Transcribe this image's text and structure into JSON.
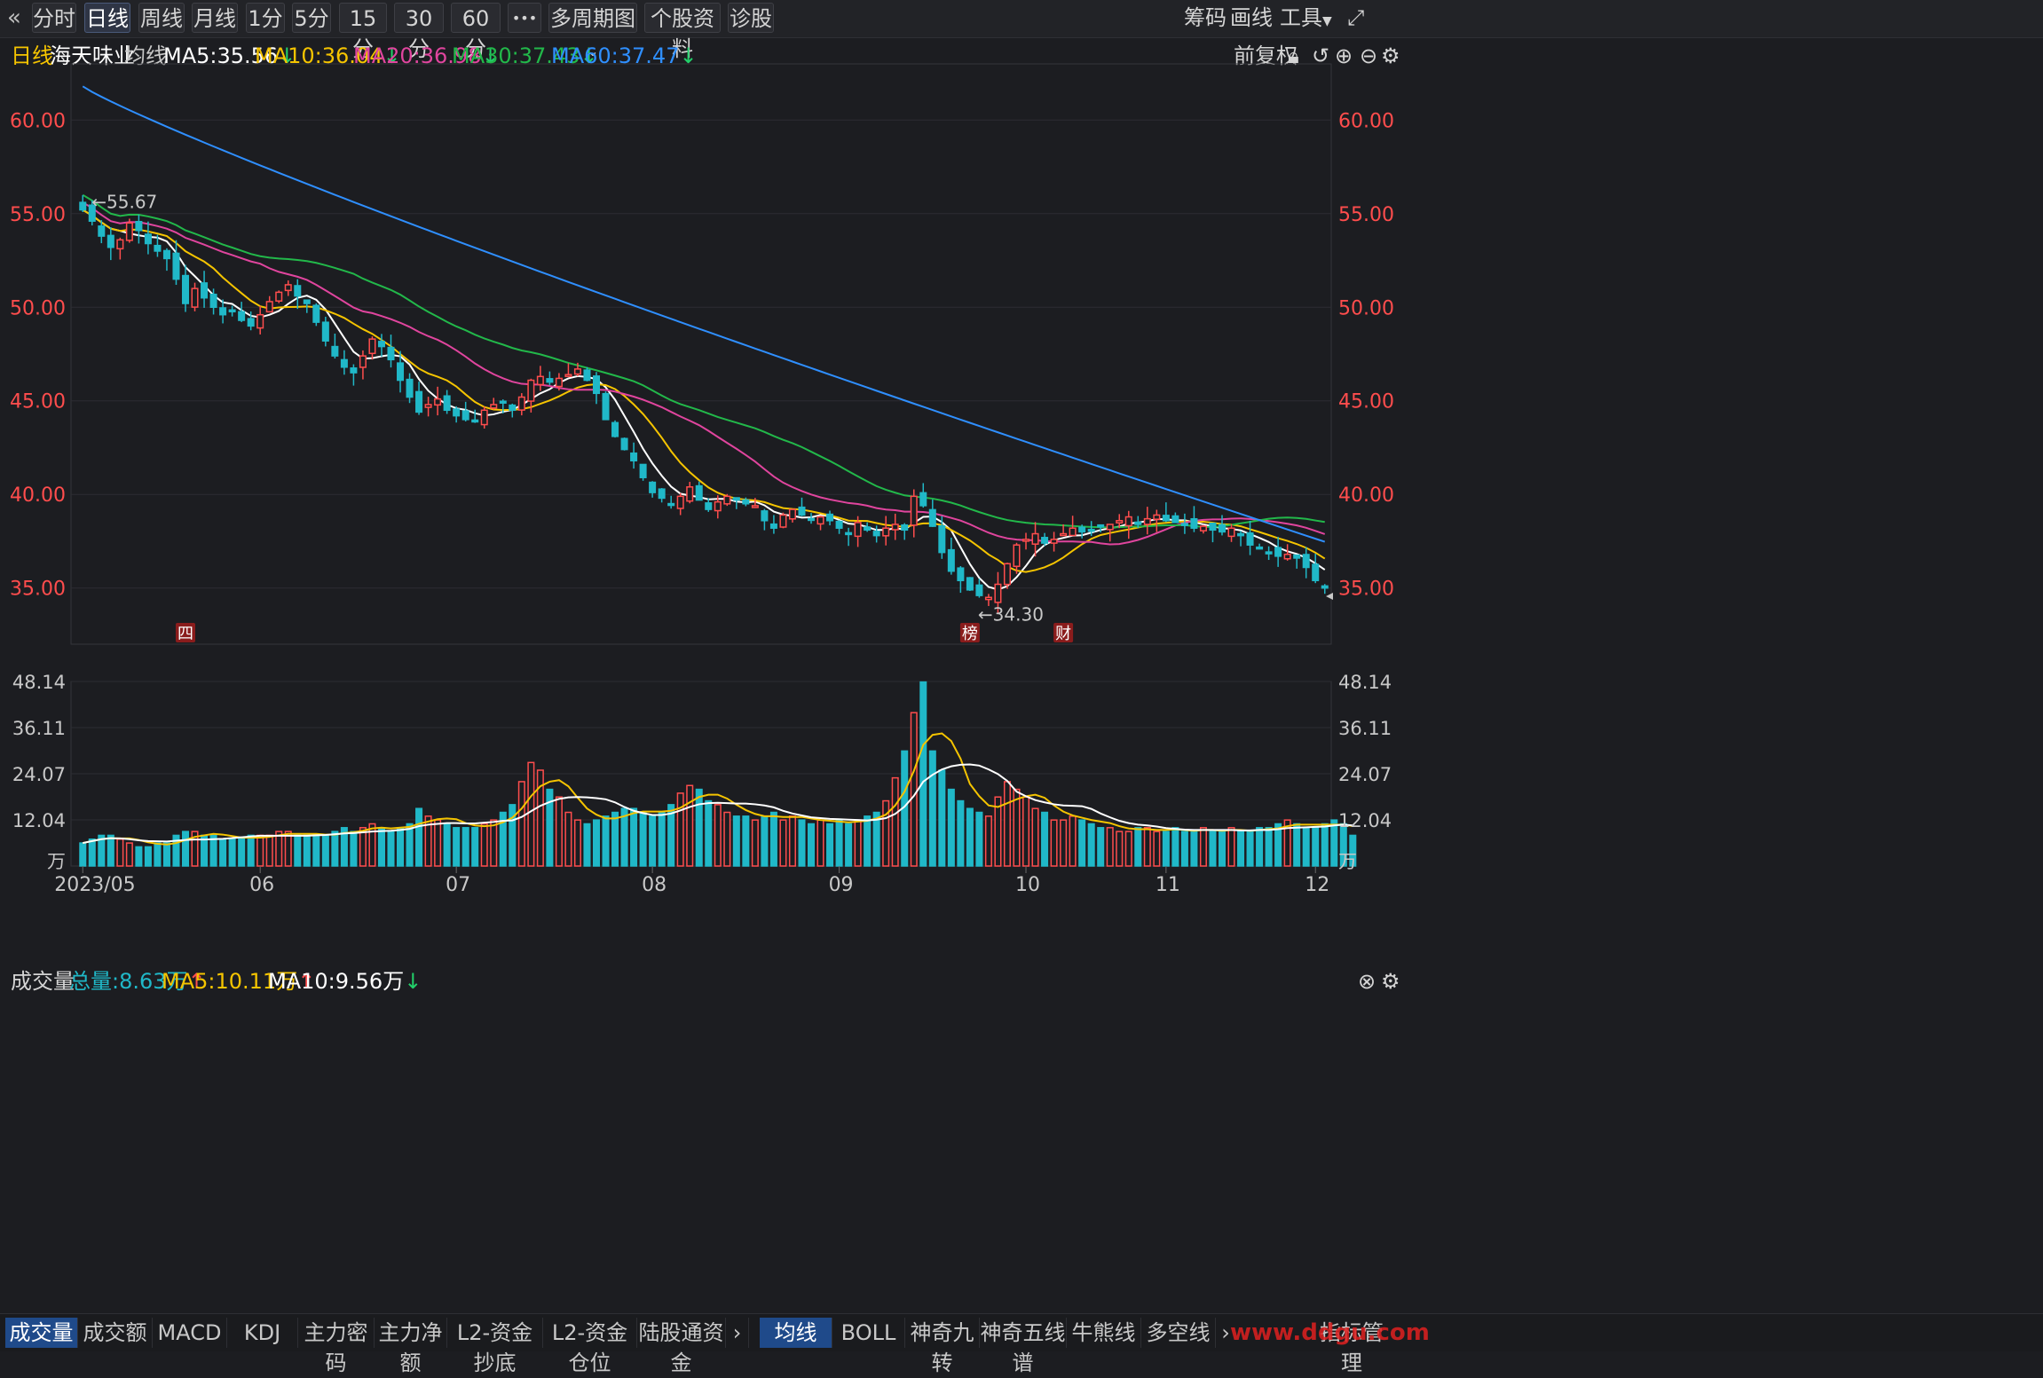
{
  "toolbar": {
    "back_icon": "double-chevron-left-icon",
    "tabs": [
      "分时",
      "日线",
      "周线",
      "月线",
      "1分",
      "5分",
      "15分",
      "30分",
      "60分",
      "•••",
      "多周期图",
      "个股资料",
      "诊股"
    ],
    "active_tab": "日线",
    "right": {
      "chips": "筹码",
      "draw": "画线",
      "tools": "工具"
    }
  },
  "info": {
    "period": "日线",
    "stock_name": "海天味业",
    "ma_label": "均线",
    "ma5": "MA5:35.56",
    "ma10": "MA10:36.04",
    "ma20": "MA20:36.98",
    "ma30": "MA30:37.43",
    "ma60": "MA60:37.47",
    "adjust": "前复权",
    "colors": {
      "ma5": "#ffffff",
      "ma10": "#f5c400",
      "ma20": "#e0459e",
      "ma30": "#22b84a",
      "ma60": "#2f8fff",
      "up": "#ff4d4d",
      "down": "#20b8c8",
      "axis_red": "#ff4d4d"
    }
  },
  "price_axis": {
    "labels": [
      "60.00",
      "55.00",
      "50.00",
      "45.00",
      "40.00",
      "35.00"
    ]
  },
  "annotations": {
    "high": "55.67",
    "low": "←34.30",
    "markers": [
      "四",
      "榜",
      "财"
    ]
  },
  "volume": {
    "title": "成交量",
    "total": "总量:8.63万",
    "ma5": "MA5:10.11万",
    "ma10": "MA10:9.56万",
    "axis": [
      "48.14",
      "36.11",
      "24.07",
      "12.04",
      "万"
    ]
  },
  "x_axis": {
    "labels": [
      "2023/05",
      "06",
      "07",
      "08",
      "09",
      "10",
      "11",
      "12"
    ]
  },
  "bottom_tabs": {
    "left": [
      "成交量",
      "成交额",
      "MACD",
      "KDJ",
      "主力密码",
      "主力净额",
      "L2-资金抄底",
      "L2-资金仓位",
      "陆股通资金"
    ],
    "right": [
      "均线",
      "BOLL",
      "神奇九转",
      "神奇五线谱",
      "牛熊线",
      "多空线"
    ],
    "manage": "指标管理",
    "watermark": "www.ddgu.com"
  },
  "chart_data": {
    "type": "candlestick",
    "title": "海天味业",
    "ylim": [
      32.0,
      63.0
    ],
    "volume_ylim": [
      0,
      48.14
    ],
    "months": [
      "2023/05",
      "06",
      "07",
      "08",
      "09",
      "10",
      "11",
      "12"
    ],
    "high": 55.67,
    "low": 34.3,
    "ma_last": {
      "MA5": 35.56,
      "MA10": 36.04,
      "MA20": 36.98,
      "MA30": 37.43,
      "MA60": 37.47
    },
    "close_path": [
      55.2,
      54.6,
      53.8,
      53.2,
      53.6,
      54.5,
      54.1,
      53.4,
      53.0,
      52.6,
      51.5,
      50.2,
      51.0,
      50.5,
      50.0,
      49.6,
      49.8,
      49.3,
      49.0,
      49.6,
      50.3,
      50.8,
      51.2,
      50.6,
      50.2,
      49.2,
      48.2,
      47.4,
      46.8,
      46.5,
      47.4,
      48.3,
      47.9,
      47.2,
      46.1,
      45.2,
      44.4,
      44.8,
      45.1,
      44.5,
      44.2,
      44.0,
      43.9,
      44.5,
      44.8,
      44.9,
      44.5,
      45.2,
      46.1,
      46.3,
      46.0,
      46.2,
      46.4,
      46.7,
      46.1,
      45.4,
      44.0,
      43.1,
      42.4,
      41.8,
      40.9,
      40.1,
      39.8,
      39.5,
      39.9,
      40.4,
      39.7,
      39.2,
      39.6,
      39.9,
      39.7,
      39.5,
      39.4,
      38.6,
      38.2,
      38.9,
      39.2,
      38.9,
      38.7,
      38.8,
      38.6,
      38.2,
      37.9,
      38.5,
      38.1,
      37.8,
      38.2,
      38.4,
      38.1,
      39.9,
      39.4,
      38.3,
      36.9,
      35.9,
      35.4,
      34.9,
      34.6,
      34.5,
      35.2,
      36.3,
      37.3,
      37.6,
      37.9,
      37.4,
      37.6,
      37.9,
      38.2,
      38.0,
      38.1,
      38.3,
      38.4,
      38.6,
      38.8,
      38.4,
      38.7,
      38.9,
      38.6,
      38.5,
      38.4,
      38.2,
      38.3,
      38.1,
      38.0,
      38.2,
      37.8,
      37.3,
      37.1,
      36.9,
      36.7,
      36.8,
      36.6,
      36.1,
      35.4,
      35.0
    ],
    "volume_path": [
      6,
      7,
      8,
      8,
      7,
      6,
      5,
      5,
      6,
      6,
      8,
      9,
      9,
      8,
      8,
      7,
      7,
      7,
      8,
      8,
      8,
      9,
      9,
      8,
      8,
      8,
      8,
      9,
      10,
      9,
      10,
      11,
      10,
      9,
      10,
      11,
      15,
      13,
      12,
      11,
      10,
      10,
      10,
      11,
      12,
      14,
      16,
      22,
      27,
      25,
      20,
      18,
      14,
      12,
      11,
      12,
      13,
      14,
      15,
      15,
      14,
      13,
      14,
      16,
      19,
      21,
      20,
      17,
      16,
      14,
      13,
      13,
      12,
      13,
      14,
      12,
      13,
      12,
      11,
      12,
      11,
      12,
      11,
      12,
      13,
      14,
      17,
      23,
      30,
      40,
      48,
      30,
      25,
      20,
      17,
      15,
      14,
      13,
      18,
      22,
      20,
      18,
      15,
      14,
      12,
      12,
      13,
      12,
      11,
      10,
      10,
      9,
      9,
      10,
      10,
      9,
      9,
      10,
      9,
      9,
      10,
      9,
      9,
      10,
      9,
      9,
      10,
      10,
      11,
      12,
      11,
      10,
      10,
      11,
      12,
      11,
      8
    ]
  }
}
